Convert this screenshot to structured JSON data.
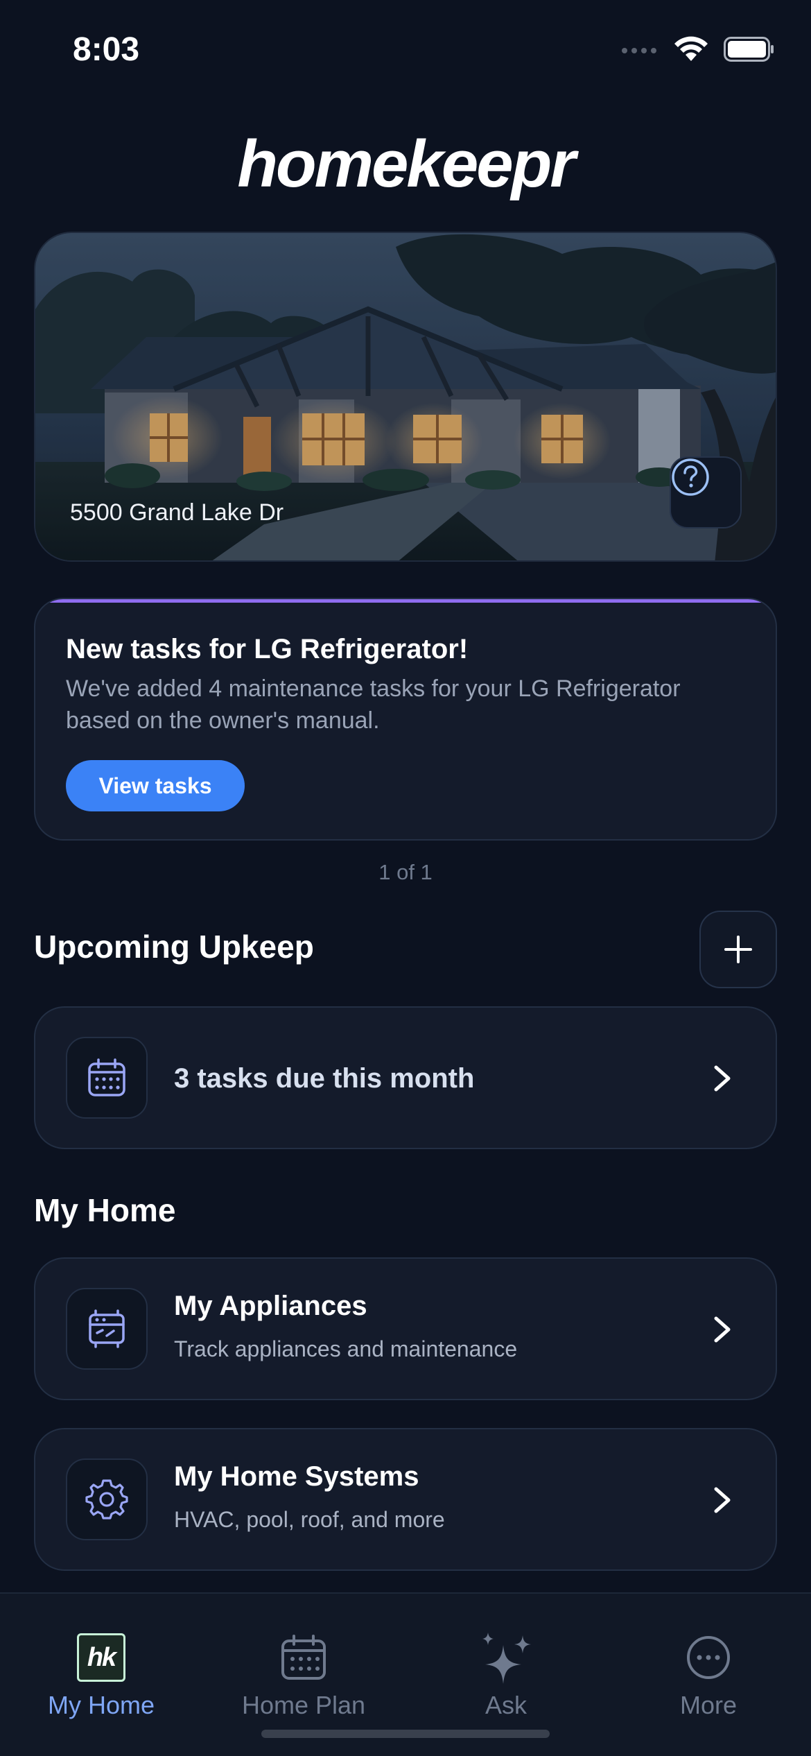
{
  "status_bar": {
    "time": "8:03"
  },
  "app": {
    "logo_text": "homekeepr"
  },
  "hero": {
    "address": "5500 Grand Lake Dr"
  },
  "notification": {
    "title": "New tasks for LG Refrigerator!",
    "body": "We've added 4 maintenance tasks for your LG Refrigerator based on the owner's manual.",
    "button_label": "View tasks",
    "pager": "1 of 1",
    "accent_color": "#8f6df0"
  },
  "upcoming": {
    "title": "Upcoming Upkeep",
    "tasks_label": "3 tasks due this month"
  },
  "my_home": {
    "title": "My Home",
    "items": [
      {
        "title": "My Appliances",
        "subtitle": "Track appliances and maintenance",
        "icon": "appliance-icon"
      },
      {
        "title": "My Home Systems",
        "subtitle": "HVAC, pool, roof, and more",
        "icon": "gear-icon"
      }
    ]
  },
  "tab_bar": {
    "logo_text": "hk",
    "tabs": [
      {
        "label": "My Home",
        "icon": "hk-logo-icon",
        "active": true
      },
      {
        "label": "Home Plan",
        "icon": "calendar-icon",
        "active": false
      },
      {
        "label": "Ask",
        "icon": "sparkle-icon",
        "active": false
      },
      {
        "label": "More",
        "icon": "more-icon",
        "active": false
      }
    ]
  },
  "colors": {
    "background": "#0c1220",
    "card": "#141b2b",
    "primary": "#3b82f6",
    "active_tab": "#7fa6f5"
  }
}
